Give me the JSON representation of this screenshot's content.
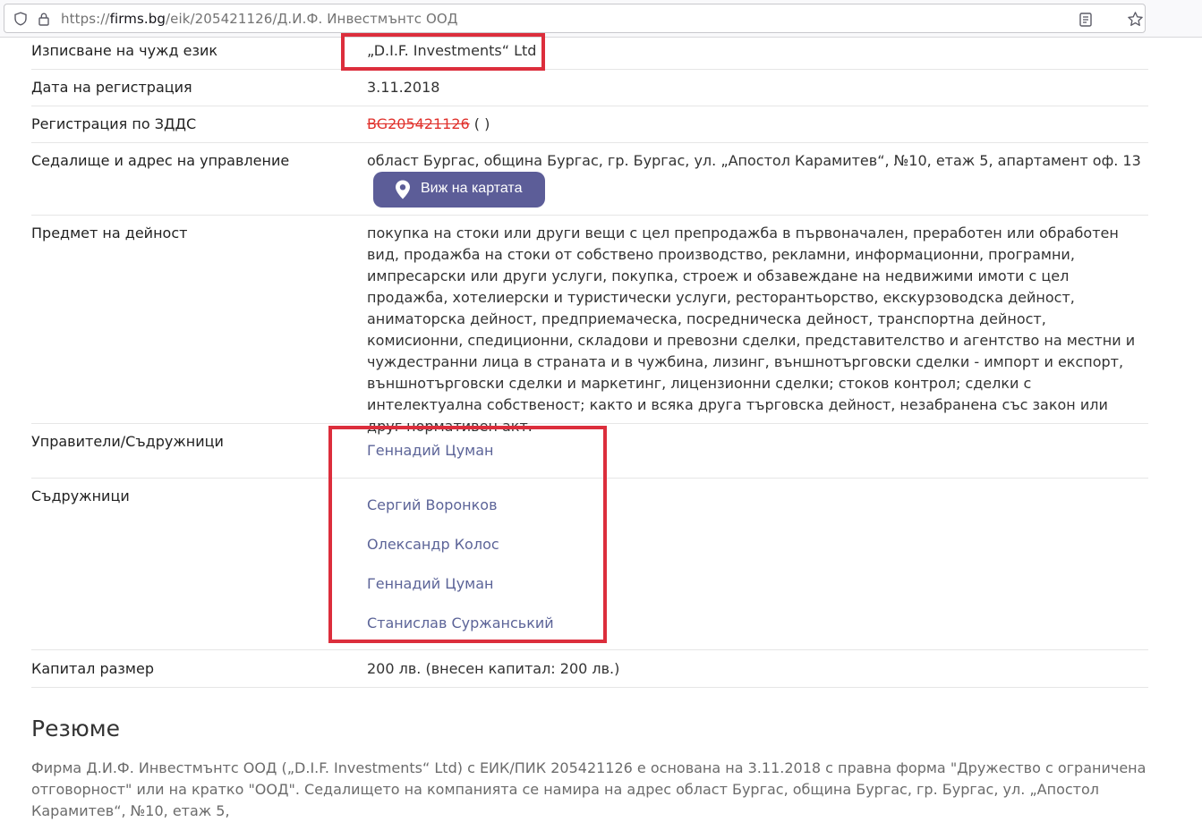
{
  "browser": {
    "url_prefix": "https://",
    "url_domain": "firms.bg",
    "url_path": "/eik/205421126/Д.И.Ф. Инвестмънтс ООД"
  },
  "rows": {
    "foreign_name": {
      "label": "Изписване на чужд език",
      "value": "„D.I.F. Investments“ Ltd"
    },
    "reg_date": {
      "label": "Дата на регистрация",
      "value": "3.11.2018"
    },
    "vat": {
      "label": "Регистрация по ЗДДС",
      "value": "BG205421126",
      "suffix": " ( )"
    },
    "address": {
      "label": "Седалище и адрес на управление",
      "value": "област Бургас, община Бургас, гр. Бургас, ул. „Апостол Карамитев“, №10, етаж 5, апартамент оф. 13",
      "map_button": "Виж на картата"
    },
    "activity": {
      "label": "Предмет на дейност",
      "value": "покупка на стоки или други вещи с цел препродажба в първоначален, преработен или обработен вид, продажба на стоки от собствено производство, рекламни, информационни, програмни, импресарски или други услуги, покупка, строеж и обзавеждане на недвижими имоти с цел продажба, хотелиерски и туристически услуги, ресторантьорство, екскурзоводска дейност, аниматорска дейност, предприемаческа, посредническа дейност, транспортна дейност, комисионни, спедиционни, складови и превозни сделки, представителство и агентство на местни и чуждестранни лица в страната и в чужбина, лизинг, външнотърговски сделки - импорт и експорт, външнотърговски сделки и маркетинг, лицензионни сделки; стоков контрол; сделки с интелектуална собственост; както и всяка друга търговска дейност, незабранена със закон или друг нормативен акт."
    },
    "managers": {
      "label": "Управители/Съдружници",
      "people": [
        "Геннадий Цуман"
      ]
    },
    "partners": {
      "label": "Съдружници",
      "people": [
        "Сергий Воронков",
        "Олександр Колос",
        "Геннадий Цуман",
        "Станислав Суржанський"
      ]
    },
    "capital": {
      "label": "Капитал размер",
      "value": "200 лв. (внесен капитал: 200 лв.)"
    }
  },
  "summary": {
    "title": "Резюме",
    "text": "Фирма Д.И.Ф. Инвестмънтс ООД („D.I.F. Investments“ Ltd) с ЕИК/ПИК 205421126 е основана на 3.11.2018 с правна форма \"Дружество с ограничена отговорност\" или на кратко \"ООД\". Седалището на компанията се намира на адрес област Бургас, община Бургас, гр. Бургас, ул. „Апостол Карамитев“, №10, етаж 5,"
  },
  "colors": {
    "highlight": "#dc2e3c",
    "link": "#5c6498",
    "button": "#5c5d98",
    "vat_strike": "#e0312c"
  }
}
